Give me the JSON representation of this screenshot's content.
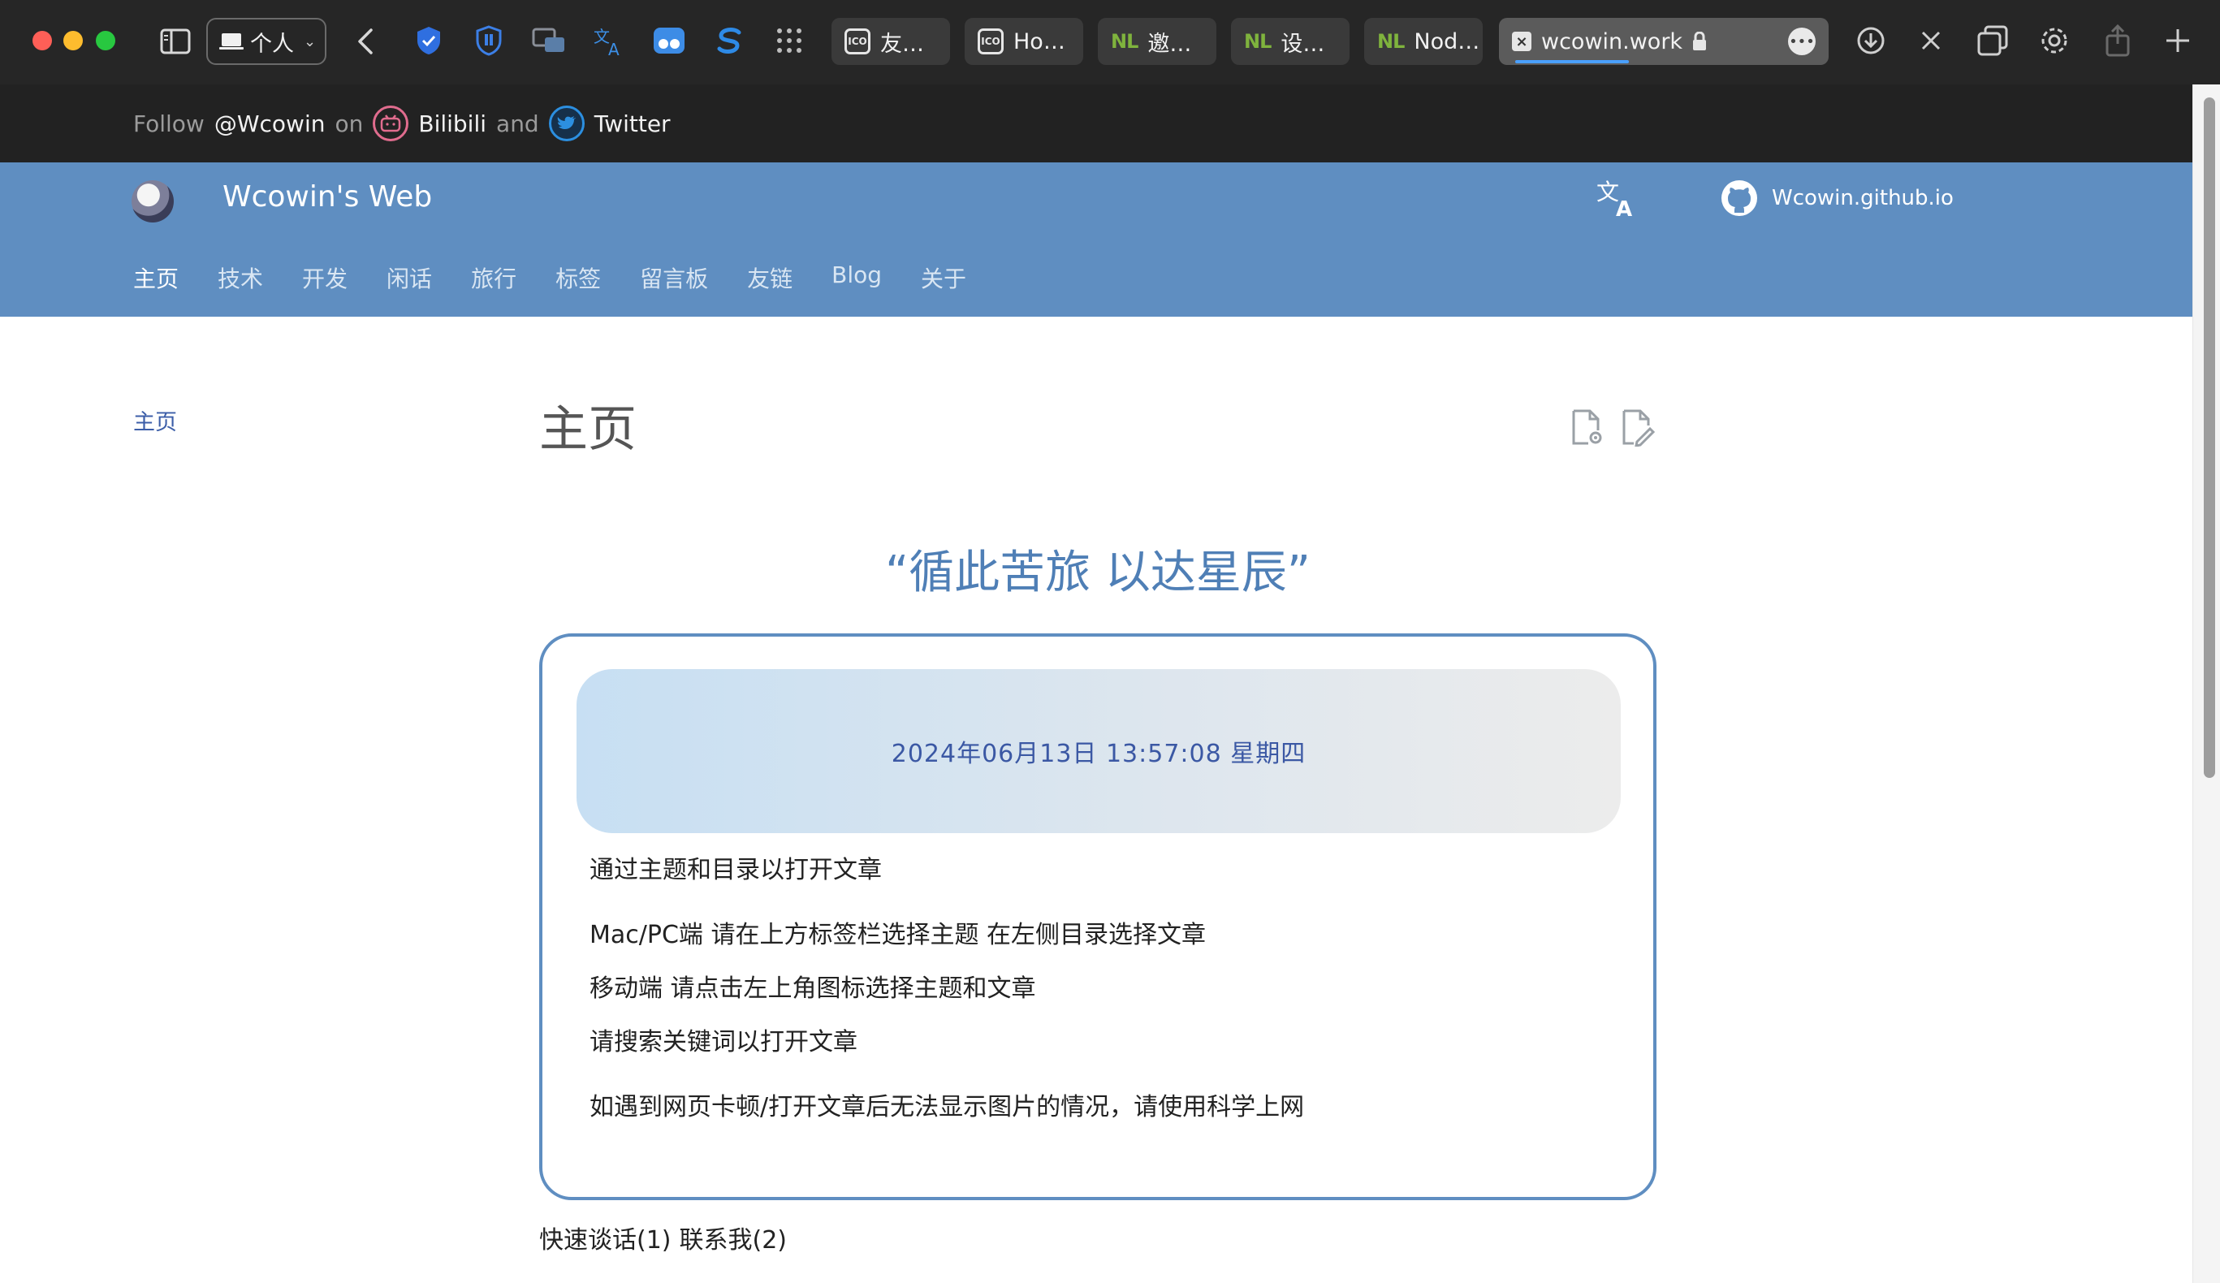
{
  "browser": {
    "profile_label": "个人",
    "tabs": [
      {
        "label": "友…",
        "favicon": "box"
      },
      {
        "label": "Ho…",
        "favicon": "box"
      },
      {
        "label": "邀…",
        "favicon": "NL"
      },
      {
        "label": "设…",
        "favicon": "NL"
      },
      {
        "label": "Nod…",
        "favicon": "NL"
      }
    ],
    "active_tab": {
      "label": "wcowin.work",
      "favicon": "x-icon"
    },
    "favicon_nl": "NL",
    "favicon_box_text": "ICO",
    "favicon_x": "×",
    "more_glyph": "•••"
  },
  "follow_bar": {
    "follow": "Follow",
    "handle": "@Wcowin",
    "on": "on",
    "bilibili": "Bilibili",
    "and": "and",
    "twitter": "Twitter"
  },
  "header": {
    "site_title": "Wcowin's Web",
    "github_label": "Wcowin.github.io",
    "nav": [
      "主页",
      "技术",
      "开发",
      "闲话",
      "旅行",
      "标签",
      "留言板",
      "友链",
      "Blog",
      "关于"
    ]
  },
  "sidebar": {
    "link": "主页"
  },
  "main": {
    "title": "主页",
    "quote": "“循此苦旅 以达星辰”",
    "datetime": "2024年06月13日 13:57:08 星期四",
    "items": [
      {
        "text": "通过主题和目录以打开文章",
        "level": 0
      },
      {
        "text": "Mac/PC端 请在上方标签栏选择主题 在左侧目录选择文章",
        "level": 1
      },
      {
        "text": "移动端 请点击左上角图标选择主题和文章",
        "level": 1
      },
      {
        "text": "请搜索关键词以打开文章",
        "level": 0
      },
      {
        "text": "如遇到网页卡顿/打开文章后无法显示图片的情况，请使用科学上网",
        "level": 0
      }
    ],
    "footer_links": [
      "快速谈话(1)",
      "联系我(2)"
    ]
  },
  "colors": {
    "header_bg": "#5f8ec1",
    "accent": "#4f7fb6",
    "date_text": "#3b58a4"
  }
}
